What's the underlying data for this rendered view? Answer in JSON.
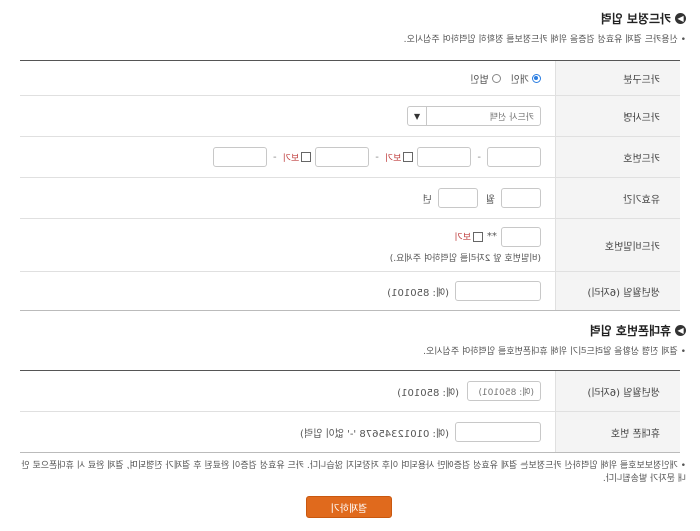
{
  "card_section": {
    "title": "카드정보 입력",
    "note": "• 신용카드 결제 유효성 검증을 위해 카드정보를 정확히 입력하여 주십시오.",
    "rows": {
      "card_type": {
        "label": "카드구분",
        "personal": "개인",
        "corporate": "법인",
        "selected": "personal"
      },
      "card_company": {
        "label": "카드사명",
        "select_value": "카드사 선택"
      },
      "card_number": {
        "label": "카드번호",
        "show_label": "보기",
        "separator": "-"
      },
      "expiry": {
        "label": "유효기간",
        "month_unit": "월",
        "year_unit": "년"
      },
      "password": {
        "label": "카드비밀번호",
        "suffix": "**",
        "show_label": "보기",
        "note": "(비밀번호 앞 2자리를 입력하여 주세요.)"
      },
      "birth": {
        "label": "생년월일 (6자리)",
        "example": "(예: 850101)"
      }
    }
  },
  "contact_section": {
    "title": "휴대폰번호 입력",
    "note": "• 결제 진행 상황을 알려드리기 위해 휴대폰번호를 입력하여 주십시오.",
    "rows": {
      "birth": {
        "label": "생년월일 (6자리)",
        "placeholder": "(예: 850101)",
        "example": "(예: 850101)"
      },
      "phone": {
        "label": "휴대폰 번호",
        "example": "(예: 01012345678 '-' 없이 입력)"
      }
    }
  },
  "bottom_note": "• 개인정보보호를 위해 입력하신 카드정보는 결제 유효성 검증에만 사용되며 이후 저장되지 않습니다. 카드 유효성 검증이 완료된 후 결제가 진행되며, 결제 완료 시 휴대폰으로 안내 문자가 발송됩니다.",
  "submit": {
    "label": "결제하기"
  },
  "colors": {
    "accent": "#e06a1d",
    "radio_on": "#2a7de1",
    "show_label": "#c04040"
  }
}
